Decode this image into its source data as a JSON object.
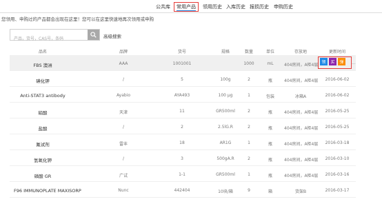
{
  "nav": {
    "tabs": [
      {
        "label": "公共库",
        "active": false
      },
      {
        "label": "常用产品",
        "active": true
      },
      {
        "label": "领用历史",
        "active": false
      },
      {
        "label": "入库历史",
        "active": false
      },
      {
        "label": "报损历史",
        "active": false
      },
      {
        "label": "申购历史",
        "active": false
      }
    ]
  },
  "hint": "您领用、申购过的产品都会出现在这里！您可以在这里快速地再次领用或申购",
  "search": {
    "placeholder": "产品，货号，CAS号，条码",
    "advanced_label": "高级搜索"
  },
  "table": {
    "headers": [
      "品名",
      "品牌",
      "货号",
      "规格",
      "数量",
      "单位",
      "存放地",
      "更新时间"
    ],
    "rows": [
      {
        "name": "FBS 澳洲",
        "brand": "AAA",
        "code": "1001001",
        "spec": "",
        "qty": "1000",
        "unit": "mL",
        "location": "404房间，A柜4层",
        "date": "",
        "highlight": true
      },
      {
        "name": "碘化钾",
        "brand": "/",
        "code": "5",
        "spec": "100g",
        "qty": "2",
        "unit": "瓶",
        "location": "404房间，A柜4层",
        "date": "2016-06-02",
        "highlight": false
      },
      {
        "name": "Anti-STAT3 antibody",
        "brand": "Ayabio",
        "code": "AYA493",
        "spec": "100 μg",
        "qty": "1",
        "unit": "包装",
        "location": "冰箱A",
        "date": "2016-06-02",
        "highlight": false
      },
      {
        "name": "硝酸",
        "brand": "天津",
        "code": "11",
        "spec": "GR500ml",
        "qty": "2",
        "unit": "瓶",
        "location": "404房间，A柜4层",
        "date": "2016-05-25",
        "highlight": false
      },
      {
        "name": "盐酸",
        "brand": "/",
        "code": "2",
        "spec": "2.5lG.R",
        "qty": "2",
        "unit": "瓶",
        "location": "404房间，A柜4层",
        "date": "2016-05-25",
        "highlight": false
      },
      {
        "name": "氟试剂",
        "brand": "雷丰",
        "code": "18",
        "spec": "AR1G",
        "qty": "1",
        "unit": "瓶",
        "location": "404房间，A柜4层",
        "date": "2016-03-18",
        "highlight": false
      },
      {
        "name": "氢氧化钾",
        "brand": "/",
        "code": "3",
        "spec": "500gA.R",
        "qty": "2",
        "unit": "瓶",
        "location": "404房间，A柜4层",
        "date": "2016-03-10",
        "highlight": false
      },
      {
        "name": "磷酸 GR",
        "brand": "广试",
        "code": "1-1",
        "spec": "GR500ml",
        "qty": "1",
        "unit": "瓶",
        "location": "404房间，A柜4层",
        "date": "2016-03-16",
        "highlight": false
      },
      {
        "name": "F96 IMMUNOPLATE MAXISORP",
        "brand": "Nunc",
        "code": "442404",
        "spec": "10块/箱",
        "qty": "9",
        "unit": "箱",
        "location": "货架B",
        "date": "2016-03-17",
        "highlight": false
      }
    ],
    "actions": [
      {
        "label": "领",
        "color": "#1e88e5"
      },
      {
        "label": "买",
        "color": "#8e24aa"
      },
      {
        "label": "弹",
        "color": "#fb8c00"
      }
    ],
    "more": "..."
  }
}
